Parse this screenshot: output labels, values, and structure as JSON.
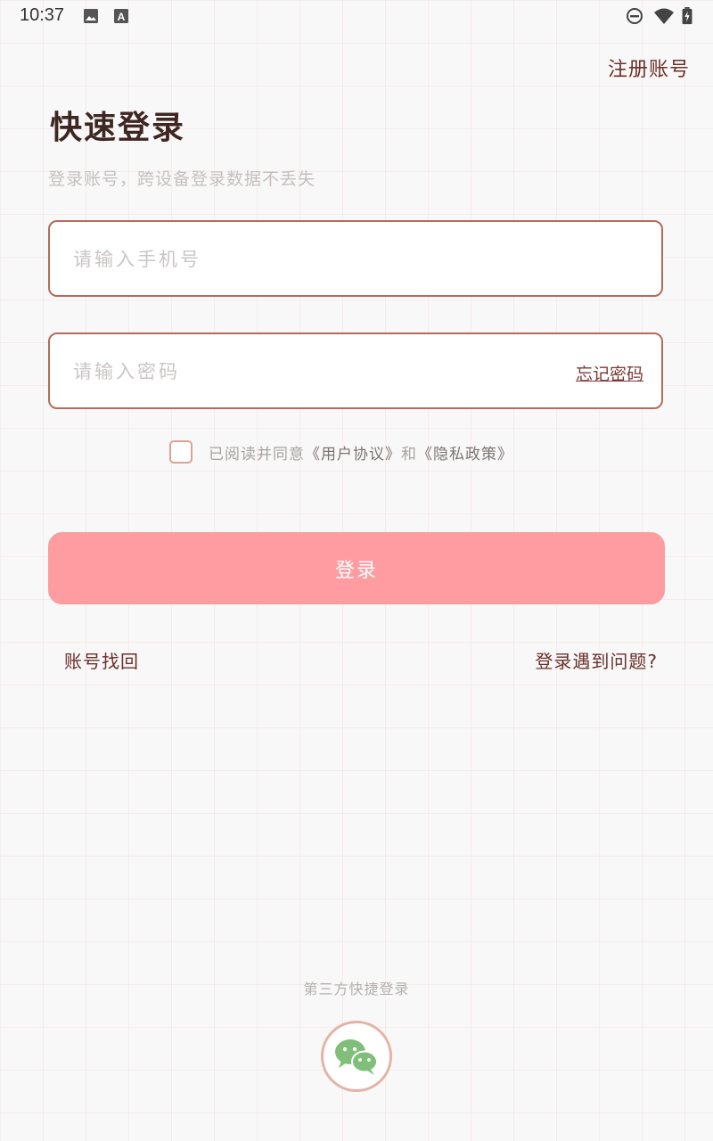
{
  "status_bar": {
    "time": "10:37",
    "left_icons": [
      "image-icon",
      "text-a-icon"
    ],
    "right_icons": [
      "do-not-disturb-icon",
      "wifi-icon",
      "battery-charging-icon"
    ]
  },
  "header": {
    "register_label": "注册账号",
    "title": "快速登录",
    "subtitle": "登录账号，跨设备登录数据不丢失"
  },
  "form": {
    "phone_placeholder": "请输入手机号",
    "password_placeholder": "请输入密码",
    "forgot_label": "忘记密码",
    "agreement": {
      "checked": false,
      "prefix": "已阅读并同意",
      "user_agreement": "《用户协议》",
      "conjunction": "和",
      "privacy_policy": "《隐私政策》"
    },
    "login_label": "登录"
  },
  "links": {
    "recover_label": "账号找回",
    "problem_label": "登录遇到问题?"
  },
  "third_party": {
    "label": "第三方快捷登录",
    "icon": "wechat-icon"
  },
  "colors": {
    "accent": "#ff9ca1",
    "border": "#b56b5a",
    "link": "#6a2f2a",
    "title": "#3e2722",
    "wechat_green": "#7fbf7a"
  }
}
